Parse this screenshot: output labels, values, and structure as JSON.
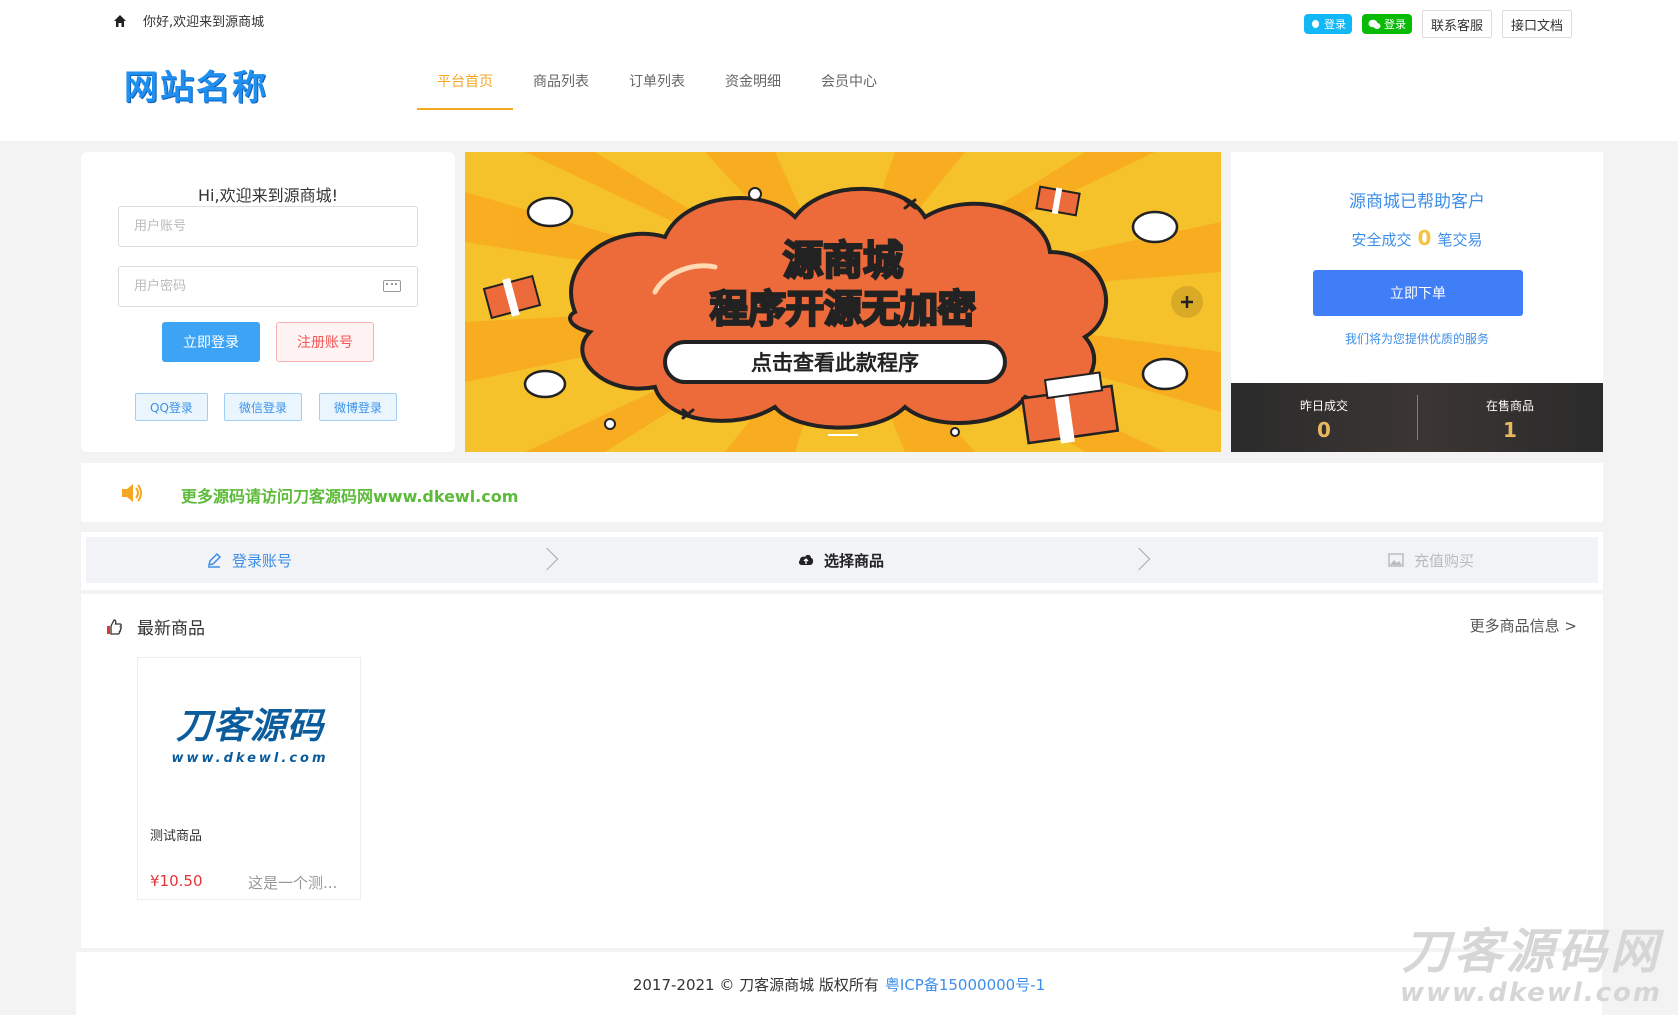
{
  "topbar": {
    "greeting": "你好,欢迎来到源商城",
    "qq_login": "登录",
    "wx_login": "登录",
    "contact": "联系客服",
    "api_docs": "接口文档"
  },
  "brand": {
    "logo_text": "网站名称"
  },
  "nav": {
    "items": [
      {
        "label": "平台首页",
        "active": true
      },
      {
        "label": "商品列表"
      },
      {
        "label": "订单列表"
      },
      {
        "label": "资金明细"
      },
      {
        "label": "会员中心"
      }
    ]
  },
  "login": {
    "title": "Hi,欢迎来到源商城!",
    "username_placeholder": "用户账号",
    "password_placeholder": "用户密码",
    "login_button": "立即登录",
    "register_button": "注册账号",
    "social": [
      "QQ登录",
      "微信登录",
      "微博登录"
    ]
  },
  "banner": {
    "line1": "源商城",
    "line2": "程序开源无加密",
    "cta": "点击查看此款程序"
  },
  "stats": {
    "title": "源商城已帮助客户",
    "prefix": "安全成交",
    "count": "0",
    "suffix": "笔交易",
    "order_button": "立即下单",
    "note": "我们将为您提供优质的服务",
    "yesterday_label": "昨日成交",
    "yesterday_value": "0",
    "onsale_label": "在售商品",
    "onsale_value": "1"
  },
  "notice": {
    "text": "更多源码请访问刀客源码网www.dkewl.com"
  },
  "steps": [
    {
      "label": "登录账号",
      "state": "done"
    },
    {
      "label": "选择商品",
      "state": "current"
    },
    {
      "label": "充值购买",
      "state": "pending"
    }
  ],
  "products": {
    "heading": "最新商品",
    "more": "更多商品信息 >",
    "items": [
      {
        "img_title": "刀客源码",
        "img_url": "www.dkewl.com",
        "name": "测试商品",
        "price": "¥10.50",
        "desc": "这是一个测..."
      }
    ]
  },
  "footer": {
    "copyright": "2017-2021 © 刀客源商城 版权所有",
    "icp": "粤ICP备15000000号-1"
  },
  "watermark": {
    "title": "刀客源码网",
    "url": "www.dkewl.com"
  },
  "colors": {
    "accent": "#f5a623",
    "primary_blue": "#3f7ef6",
    "notice_green": "#5dbb3a",
    "price_red": "#e33535"
  }
}
